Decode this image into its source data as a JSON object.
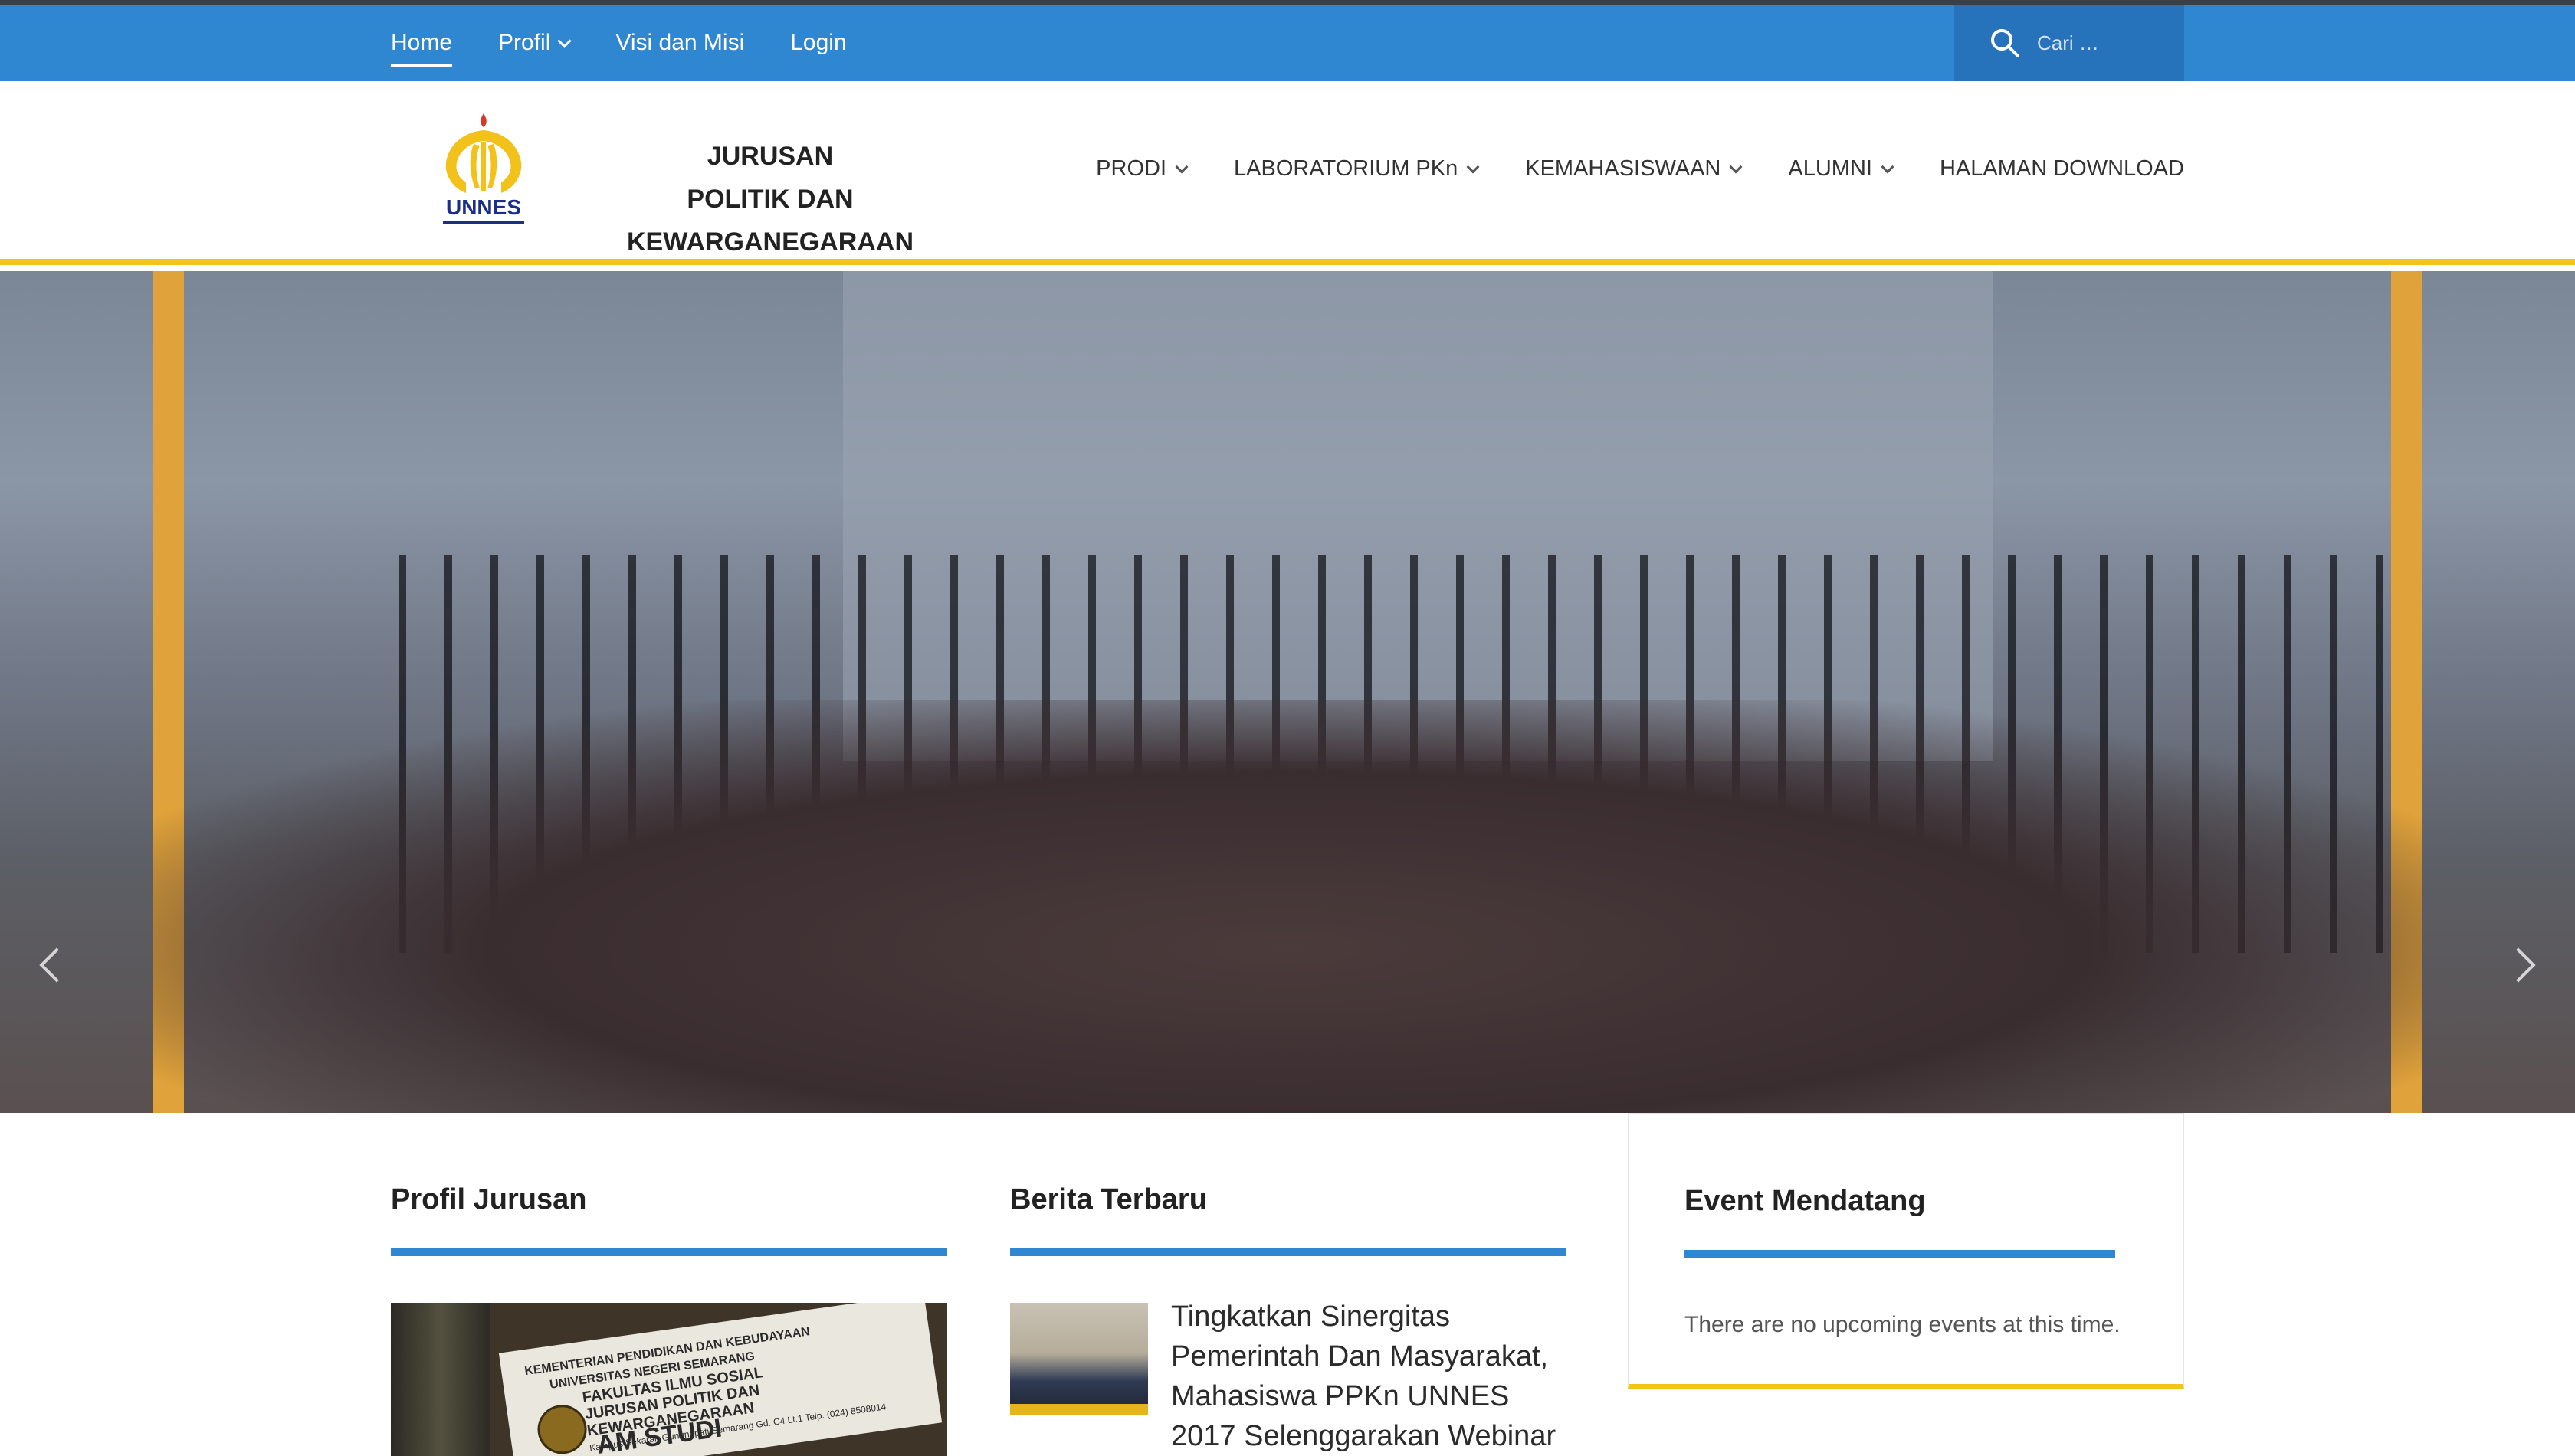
{
  "topbar": {
    "nav": [
      {
        "label": "Home",
        "active": true
      },
      {
        "label": "Profil",
        "dropdown": true
      },
      {
        "label": "Visi dan Misi"
      },
      {
        "label": "Login"
      }
    ],
    "search_placeholder": "Cari …"
  },
  "header": {
    "logo_text": "UNNES",
    "brand_line1": "JURUSAN",
    "brand_line2": "POLITIK DAN KEWARGANEGARAAN",
    "nav": [
      {
        "label": "PRODI",
        "dropdown": true
      },
      {
        "label": "LABORATORIUM PKn",
        "dropdown": true
      },
      {
        "label": "KEMAHASISWAAN",
        "dropdown": true
      },
      {
        "label": "ALUMNI",
        "dropdown": true
      },
      {
        "label": "HALAMAN DOWNLOAD"
      }
    ]
  },
  "slider": {
    "slide_count": 9,
    "active_index": 4
  },
  "sections": {
    "profil": {
      "title": "Profil Jurusan",
      "image_sign": {
        "line1": "KEMENTERIAN PENDIDIKAN DAN KEBUDAYAAN",
        "line2": "UNIVERSITAS NEGERI SEMARANG",
        "line3": "FAKULTAS ILMU SOSIAL",
        "line4": "JURUSAN POLITIK DAN KEWARGANEGARAAN",
        "line5": "Kampus Sekaran Gunungpati Semarang Gd. C4 Lt.1 Telp. (024) 8508014",
        "line6": "AM STUDI"
      }
    },
    "berita": {
      "title": "Berita Terbaru",
      "item_title": "Tingkatkan Sinergitas Pemerintah Dan Masyarakat, Mahasiswa PPKn UNNES 2017 Selenggarakan Webinar"
    },
    "event": {
      "title": "Event Mendatang",
      "message": "There are no upcoming events at this time."
    }
  },
  "colors": {
    "primary_blue": "#2f86d1",
    "accent_yellow": "#f3c419"
  }
}
